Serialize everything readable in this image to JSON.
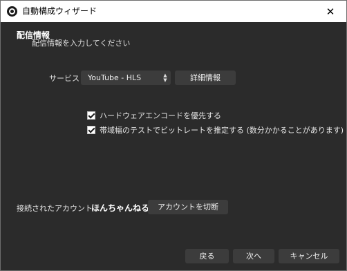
{
  "window": {
    "title": "自動構成ウィザード",
    "close_glyph": "✕",
    "app_icon": "obs-logo-icon"
  },
  "header": {
    "title": "配信情報",
    "subtitle": "配信情報を入力してください"
  },
  "service": {
    "label": "サービス",
    "selected": "YouTube - HLS",
    "arrow_up": "▲",
    "arrow_down": "▼",
    "details_button": "詳細情報"
  },
  "options": [
    {
      "label": "ハードウェアエンコードを優先する",
      "checked": true
    },
    {
      "label": "帯域幅のテストでビットレートを推定する (数分かかることがあります)",
      "checked": true
    }
  ],
  "account": {
    "label": "接続されたアカウント",
    "name": "ほんちゃんねる",
    "disconnect_button": "アカウントを切断"
  },
  "footer": {
    "back": "戻る",
    "next": "次へ",
    "cancel": "キャンセル"
  },
  "colors": {
    "background": "#2b2b2b",
    "button": "#3c3c3c",
    "titlebar": "#ffffff"
  }
}
